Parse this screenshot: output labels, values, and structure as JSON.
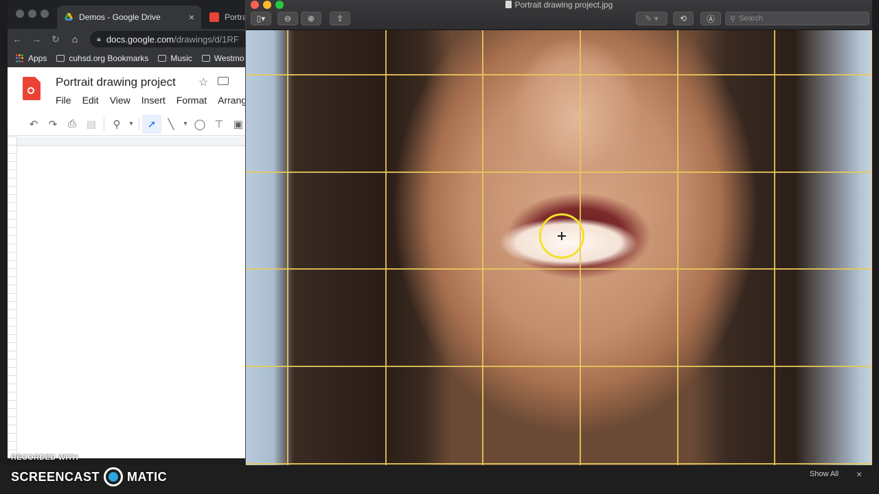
{
  "chrome": {
    "tabs": [
      {
        "label": "Demos - Google Drive",
        "icon": "google-drive-icon"
      },
      {
        "label": "Portrai",
        "icon": "google-drawings-icon"
      }
    ],
    "url_host": "docs.google.com",
    "url_path": "/drawings/d/1RF",
    "bookmarks": [
      "Apps",
      "cuhsd.org Bookmarks",
      "Music",
      "Westmo"
    ]
  },
  "drawings": {
    "title": "Portrait drawing project",
    "menu": [
      "File",
      "Edit",
      "View",
      "Insert",
      "Format",
      "Arrange"
    ]
  },
  "preview": {
    "filename": "Portrait drawing project.jpg",
    "search_placeholder": "Search",
    "grid_color": "#e8c95a"
  },
  "bottom": {
    "show_all": "Show All",
    "close": "×",
    "watermark_small": "RECORDED WITH",
    "watermark_left": "SCREENCAST",
    "watermark_right": "MATIC"
  }
}
